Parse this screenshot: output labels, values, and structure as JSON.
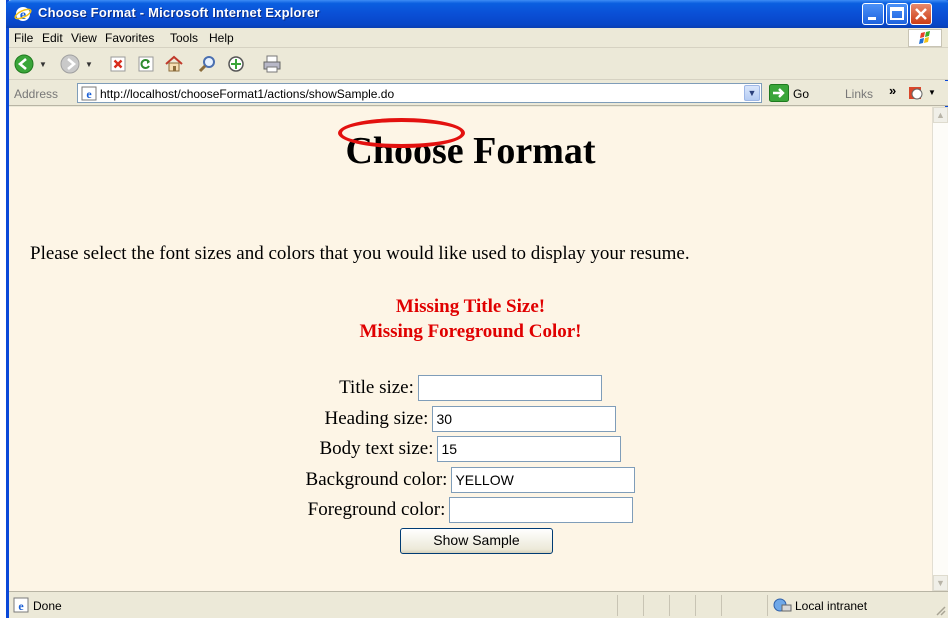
{
  "window": {
    "title": "Choose Format - Microsoft Internet Explorer",
    "icons": [
      "ie-icon",
      "minimize-icon",
      "maximize-icon",
      "close-icon"
    ]
  },
  "menu": {
    "items": [
      "File",
      "Edit",
      "View",
      "Favorites",
      "Tools",
      "Help"
    ]
  },
  "toolbar": {
    "icons": [
      "back-icon",
      "forward-icon",
      "stop-icon",
      "refresh-icon",
      "home-icon",
      "search-icon",
      "favorites-icon",
      "print-icon"
    ]
  },
  "address": {
    "label": "Address",
    "url": "http://localhost/chooseFormat1/actions/showSample.do",
    "go_label": "Go",
    "links_label": "Links",
    "links_chevron": "»"
  },
  "colors": {
    "annotation": "#e3110f",
    "error": "#e00000",
    "page_background": "#fdf5e6",
    "title_bar": "#0a4fd6"
  },
  "page": {
    "title": "Choose Format",
    "intro": "Please select the font sizes and colors that you would like used to display your resume.",
    "errors": [
      "Missing Title Size!",
      "Missing Foreground Color!"
    ],
    "fields": [
      {
        "label": "Title size:",
        "value": ""
      },
      {
        "label": "Heading size:",
        "value": "30"
      },
      {
        "label": "Body text size:",
        "value": "15"
      },
      {
        "label": "Background color:",
        "value": "YELLOW"
      },
      {
        "label": "Foreground color:",
        "value": ""
      }
    ],
    "submit_label": "Show Sample"
  },
  "status": {
    "text": "Done",
    "zone": "Local intranet"
  }
}
